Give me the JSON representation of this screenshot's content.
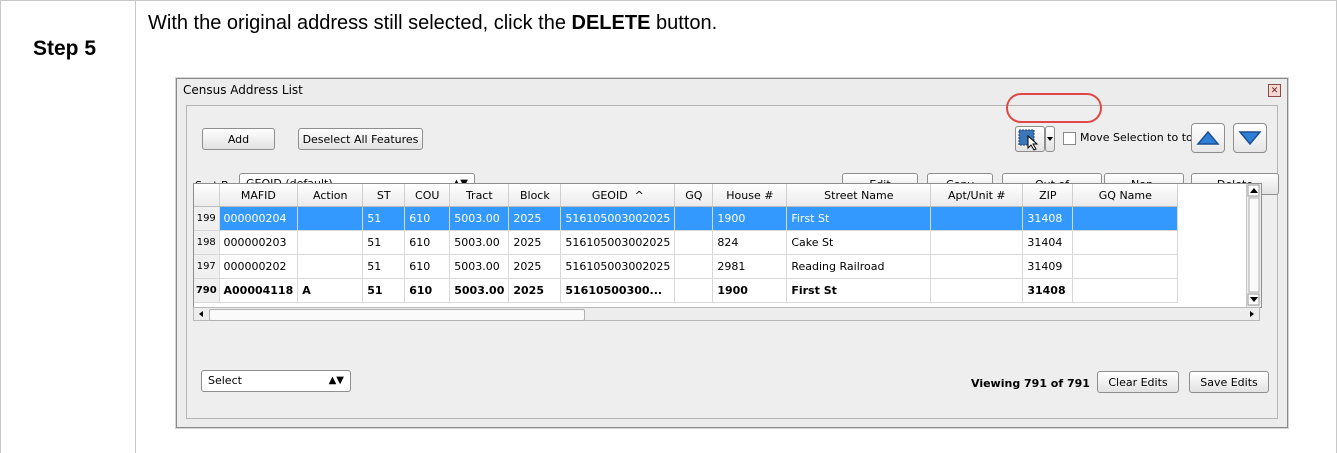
{
  "step": {
    "label": "Step 5"
  },
  "instruction": {
    "prefix": "With the original address still selected, click the ",
    "emphasis": "DELETE",
    "suffix": " button."
  },
  "dialog": {
    "title": "Census Address List",
    "buttons": {
      "add": "Add",
      "deselect_all": "Deselect All Features",
      "edit": "Edit",
      "copy": "Copy",
      "out_of_jurisdiction": "Out of Jurisdiction",
      "non_residential": "Non-Residential",
      "delete": "Delete",
      "clear_edits": "Clear Edits",
      "save_edits": "Save Edits"
    },
    "move_selection_label": "Move Selection to top",
    "sort_by_label": "Sort By:",
    "sort_by_value": "GEOID (default)",
    "select_value": "Select",
    "viewing": "Viewing 791 of 791",
    "columns": [
      "MAFID",
      "Action",
      "ST",
      "COU",
      "Tract",
      "Block",
      "GEOID",
      "GQ",
      "House #",
      "Street Name",
      "Apt/Unit #",
      "ZIP",
      "GQ Name"
    ],
    "sort_indicator": "^",
    "rows": [
      {
        "rn": "199",
        "cells": [
          "000000204",
          "",
          "51",
          "610",
          "5003.00",
          "2025",
          "516105003002025",
          "",
          "1900",
          "First St",
          "",
          "31408",
          ""
        ],
        "selected": true,
        "bold": false
      },
      {
        "rn": "198",
        "cells": [
          "000000203",
          "",
          "51",
          "610",
          "5003.00",
          "2025",
          "516105003002025",
          "",
          "824",
          "Cake St",
          "",
          "31404",
          ""
        ],
        "selected": false,
        "bold": false
      },
      {
        "rn": "197",
        "cells": [
          "000000202",
          "",
          "51",
          "610",
          "5003.00",
          "2025",
          "516105003002025",
          "",
          "2981",
          "Reading Railroad",
          "",
          "31409",
          ""
        ],
        "selected": false,
        "bold": false
      },
      {
        "rn": "790",
        "cells": [
          "A00004118",
          "A",
          "51",
          "610",
          "5003.00",
          "2025",
          "51610500300...",
          "",
          "1900",
          "First St",
          "",
          "31408",
          ""
        ],
        "selected": false,
        "bold": true
      }
    ],
    "colors": {
      "selection": "#3399ff",
      "highlight_ring": "#e04848",
      "arrow": "#2f7fd8"
    },
    "icons": [
      "close-icon",
      "selection-tool-icon",
      "dropdown-arrow-icon",
      "move-up-icon",
      "move-down-icon",
      "spin-icon"
    ]
  }
}
